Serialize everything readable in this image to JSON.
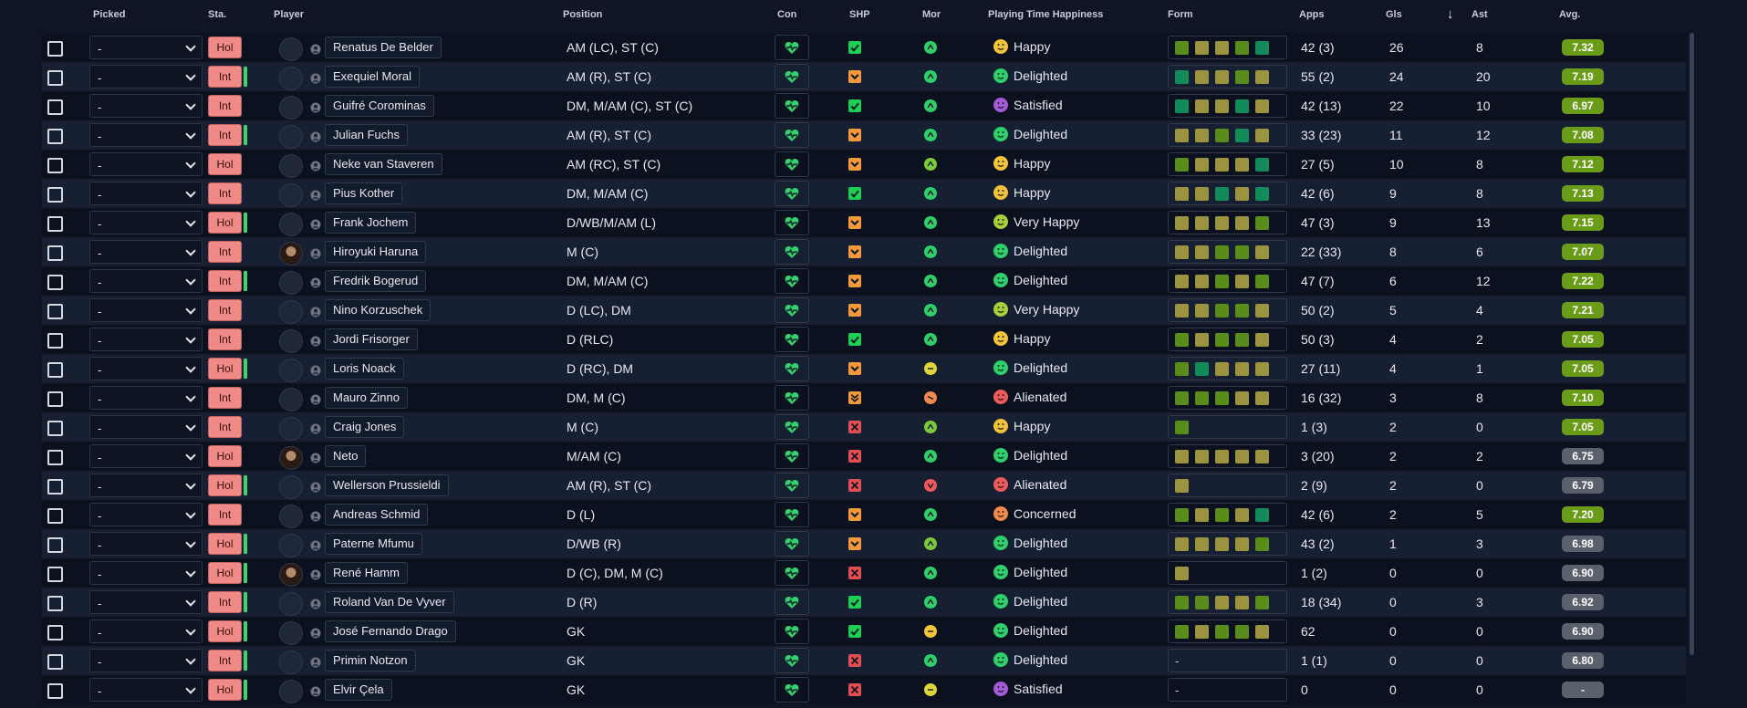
{
  "headers": {
    "picked": "Picked",
    "sta": "Sta.",
    "player": "Player",
    "position": "Position",
    "con": "Con",
    "shp": "SHP",
    "mor": "Mor",
    "pth": "Playing Time Happiness",
    "form": "Form",
    "apps": "Apps",
    "gls": "Gls",
    "ast": "Ast",
    "avg": "Avg.",
    "sort_icon": "arrow-down-icon"
  },
  "picked_default": "-",
  "colors": {
    "form_green": "#5a8c1c",
    "form_olive": "#9c9340",
    "form_teal": "#138a5a",
    "shp_good": "#1fcf52",
    "shp_mid": "#f29a3b",
    "shp_bad": "#e35050",
    "con": "#35d16a",
    "happy": "#f2c33b",
    "delighted": "#2fcf6a",
    "satisfied": "#a55ad8",
    "very_happy": "#a6d03a",
    "alienated": "#f05a5a",
    "concerned": "#f2894b",
    "avg_green": "#6a9c1a",
    "avg_grey": "#5a616d"
  },
  "rows": [
    {
      "sta": "Hol",
      "bar": false,
      "name": "Renatus De Belder",
      "photo": false,
      "pos": "AM (LC), ST (C)",
      "shp": "good",
      "mor": "good",
      "pth": "Happy",
      "form": [
        "G",
        "O",
        "O",
        "G",
        "T"
      ],
      "apps": "42 (3)",
      "gls": "26",
      "ast": "8",
      "avg": "7.32",
      "avgc": "green"
    },
    {
      "sta": "Int",
      "bar": true,
      "name": "Exequiel Moral",
      "photo": false,
      "pos": "AM (R), ST (C)",
      "shp": "mid",
      "mor": "good",
      "pth": "Delighted",
      "form": [
        "T",
        "O",
        "O",
        "G",
        "O"
      ],
      "apps": "55 (2)",
      "gls": "24",
      "ast": "20",
      "avg": "7.19",
      "avgc": "green"
    },
    {
      "sta": "Int",
      "bar": false,
      "name": "Guifré Corominas",
      "photo": false,
      "pos": "DM, M/AM (C), ST (C)",
      "shp": "good",
      "mor": "good",
      "pth": "Satisfied",
      "form": [
        "T",
        "O",
        "O",
        "T",
        "O"
      ],
      "apps": "42 (13)",
      "gls": "22",
      "ast": "10",
      "avg": "6.97",
      "avgc": "green"
    },
    {
      "sta": "Int",
      "bar": true,
      "name": "Julian Fuchs",
      "photo": false,
      "pos": "AM (R), ST (C)",
      "shp": "mid",
      "mor": "good",
      "pth": "Delighted",
      "form": [
        "O",
        "O",
        "G",
        "T",
        "O"
      ],
      "apps": "33 (23)",
      "gls": "11",
      "ast": "12",
      "avg": "7.08",
      "avgc": "green"
    },
    {
      "sta": "Hol",
      "bar": false,
      "name": "Neke van Staveren",
      "photo": false,
      "pos": "AM (RC), ST (C)",
      "shp": "mid",
      "mor": "ok",
      "pth": "Happy",
      "form": [
        "G",
        "O",
        "O",
        "O",
        "T"
      ],
      "apps": "27 (5)",
      "gls": "10",
      "ast": "8",
      "avg": "7.12",
      "avgc": "green"
    },
    {
      "sta": "Int",
      "bar": false,
      "name": "Pius Kother",
      "photo": false,
      "pos": "DM, M/AM (C)",
      "shp": "good",
      "mor": "good",
      "pth": "Happy",
      "form": [
        "O",
        "O",
        "T",
        "O",
        "T"
      ],
      "apps": "42 (6)",
      "gls": "9",
      "ast": "8",
      "avg": "7.13",
      "avgc": "green"
    },
    {
      "sta": "Hol",
      "bar": true,
      "name": "Frank Jochem",
      "photo": false,
      "pos": "D/WB/M/AM (L)",
      "shp": "mid",
      "mor": "good",
      "pth": "Very Happy",
      "form": [
        "O",
        "O",
        "O",
        "O",
        "G"
      ],
      "apps": "47 (3)",
      "gls": "9",
      "ast": "13",
      "avg": "7.15",
      "avgc": "green"
    },
    {
      "sta": "Int",
      "bar": false,
      "name": "Hiroyuki Haruna",
      "photo": true,
      "pos": "M (C)",
      "shp": "mid",
      "mor": "good",
      "pth": "Delighted",
      "form": [
        "O",
        "O",
        "G",
        "G",
        "O"
      ],
      "apps": "22 (33)",
      "gls": "8",
      "ast": "6",
      "avg": "7.07",
      "avgc": "green"
    },
    {
      "sta": "Int",
      "bar": true,
      "name": "Fredrik Bogerud",
      "photo": false,
      "pos": "DM, M/AM (C)",
      "shp": "mid",
      "mor": "good",
      "pth": "Delighted",
      "form": [
        "O",
        "O",
        "G",
        "O",
        "G"
      ],
      "apps": "47 (7)",
      "gls": "6",
      "ast": "12",
      "avg": "7.22",
      "avgc": "green"
    },
    {
      "sta": "Int",
      "bar": false,
      "name": "Nino Korzuschek",
      "photo": false,
      "pos": "D (LC), DM",
      "shp": "mid",
      "mor": "good",
      "pth": "Very Happy",
      "form": [
        "O",
        "O",
        "G",
        "G",
        "O"
      ],
      "apps": "50 (2)",
      "gls": "5",
      "ast": "4",
      "avg": "7.21",
      "avgc": "green"
    },
    {
      "sta": "Int",
      "bar": false,
      "name": "Jordi Frisorger",
      "photo": false,
      "pos": "D (RLC)",
      "shp": "good",
      "mor": "good",
      "pth": "Happy",
      "form": [
        "G",
        "O",
        "G",
        "G",
        "O"
      ],
      "apps": "50 (3)",
      "gls": "4",
      "ast": "2",
      "avg": "7.05",
      "avgc": "green"
    },
    {
      "sta": "Hol",
      "bar": true,
      "name": "Loris Noack",
      "photo": false,
      "pos": "D (RC), DM",
      "shp": "mid",
      "mor": "yellow",
      "pth": "Delighted",
      "form": [
        "G",
        "T",
        "O",
        "O",
        "O"
      ],
      "apps": "27 (11)",
      "gls": "4",
      "ast": "1",
      "avg": "7.05",
      "avgc": "green"
    },
    {
      "sta": "Int",
      "bar": false,
      "name": "Mauro Zinno",
      "photo": false,
      "pos": "DM, M (C)",
      "shp": "downmid",
      "mor": "orange",
      "pth": "Alienated",
      "form": [
        "G",
        "G",
        "G",
        "O",
        "O"
      ],
      "apps": "16 (32)",
      "gls": "3",
      "ast": "8",
      "avg": "7.10",
      "avgc": "green"
    },
    {
      "sta": "Int",
      "bar": false,
      "name": "Craig Jones",
      "photo": false,
      "pos": "M (C)",
      "shp": "bad",
      "mor": "ok",
      "pth": "Happy",
      "form": [
        "G"
      ],
      "apps": "1 (3)",
      "gls": "2",
      "ast": "0",
      "avg": "7.05",
      "avgc": "green"
    },
    {
      "sta": "Hol",
      "bar": false,
      "name": "Neto",
      "photo": true,
      "pos": "M/AM (C)",
      "shp": "bad",
      "mor": "good",
      "pth": "Delighted",
      "form": [
        "O",
        "O",
        "O",
        "O",
        "O"
      ],
      "apps": "3 (20)",
      "gls": "2",
      "ast": "2",
      "avg": "6.75",
      "avgc": "grey"
    },
    {
      "sta": "Hol",
      "bar": true,
      "name": "Wellerson Prussieldi",
      "photo": false,
      "pos": "AM (R), ST (C)",
      "shp": "bad",
      "mor": "red",
      "pth": "Alienated",
      "form": [
        "O"
      ],
      "apps": "2 (9)",
      "gls": "2",
      "ast": "0",
      "avg": "6.79",
      "avgc": "grey"
    },
    {
      "sta": "Int",
      "bar": false,
      "name": "Andreas Schmid",
      "photo": false,
      "pos": "D (L)",
      "shp": "mid",
      "mor": "good",
      "pth": "Concerned",
      "form": [
        "G",
        "O",
        "G",
        "O",
        "T"
      ],
      "apps": "42 (6)",
      "gls": "2",
      "ast": "5",
      "avg": "7.20",
      "avgc": "green"
    },
    {
      "sta": "Hol",
      "bar": true,
      "name": "Paterne Mfumu",
      "photo": false,
      "pos": "D/WB (R)",
      "shp": "mid",
      "mor": "ok",
      "pth": "Delighted",
      "form": [
        "O",
        "O",
        "O",
        "O",
        "G"
      ],
      "apps": "43 (2)",
      "gls": "1",
      "ast": "3",
      "avg": "6.98",
      "avgc": "grey"
    },
    {
      "sta": "Hol",
      "bar": true,
      "name": "René Hamm",
      "photo": true,
      "pos": "D (C), DM, M (C)",
      "shp": "bad",
      "mor": "good",
      "pth": "Delighted",
      "form": [
        "O"
      ],
      "apps": "1 (2)",
      "gls": "0",
      "ast": "0",
      "avg": "6.90",
      "avgc": "grey"
    },
    {
      "sta": "Int",
      "bar": true,
      "name": "Roland Van De Vyver",
      "photo": false,
      "pos": "D (R)",
      "shp": "good",
      "mor": "good",
      "pth": "Delighted",
      "form": [
        "G",
        "G",
        "O",
        "O",
        "G"
      ],
      "apps": "18 (34)",
      "gls": "0",
      "ast": "3",
      "avg": "6.92",
      "avgc": "grey"
    },
    {
      "sta": "Hol",
      "bar": true,
      "name": "José Fernando Drago",
      "photo": false,
      "pos": "GK",
      "shp": "good",
      "mor": "yellowdash",
      "pth": "Delighted",
      "form": [
        "G",
        "O",
        "G",
        "G",
        "O"
      ],
      "apps": "62",
      "gls": "0",
      "ast": "0",
      "avg": "6.90",
      "avgc": "grey"
    },
    {
      "sta": "Int",
      "bar": true,
      "name": "Primin Notzon",
      "photo": false,
      "pos": "GK",
      "shp": "bad",
      "mor": "good",
      "pth": "Delighted",
      "form": [],
      "apps": "1 (1)",
      "gls": "0",
      "ast": "0",
      "avg": "6.80",
      "avgc": "grey"
    },
    {
      "sta": "Hol",
      "bar": true,
      "name": "Elvir Çela",
      "photo": false,
      "pos": "GK",
      "shp": "bad",
      "mor": "yellow",
      "pth": "Satisfied",
      "form": [],
      "apps": "0",
      "gls": "0",
      "ast": "0",
      "avg": "-",
      "avgc": "grey"
    }
  ]
}
